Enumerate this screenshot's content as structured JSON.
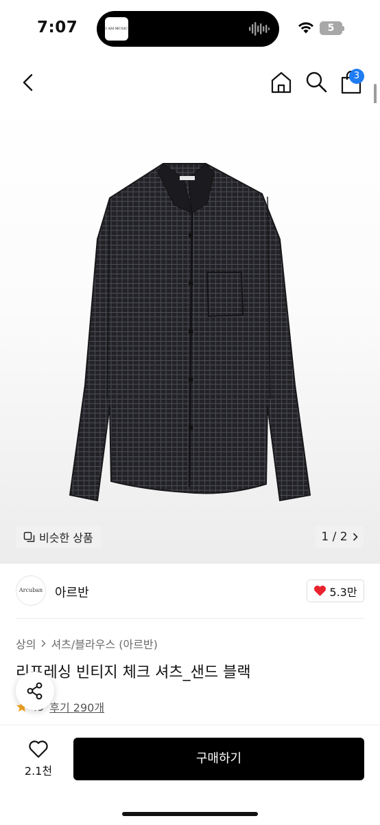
{
  "status_bar": {
    "time": "7:07",
    "battery_level": "5",
    "now_playing_thumb_text": "I AM MUSIC"
  },
  "header": {
    "back_icon": "chevron-left-icon",
    "home_icon": "home-icon",
    "search_icon": "search-icon",
    "cart_icon": "shopping-bag-icon",
    "cart_count": "3",
    "accent_color": "#1f7cf2"
  },
  "gallery": {
    "similar_label": "비슷한 상품",
    "page_indicator": "1 / 2",
    "product_image": "black-check-shirt"
  },
  "brand": {
    "logo_text": "Arcuban",
    "name": "아르반",
    "like_count": "5.3만",
    "like_color": "#e8232f"
  },
  "product": {
    "breadcrumb": [
      "상의",
      "셔츠/블라우스 (아르반)"
    ],
    "title": "리프레싱 빈티지 체크 셔츠_샌드 블랙",
    "rating": "4.9",
    "rating_display": ".9",
    "reviews": "후기 290개"
  },
  "bottom_bar": {
    "wish_count": "2.1천",
    "buy_label": "구매하기"
  }
}
